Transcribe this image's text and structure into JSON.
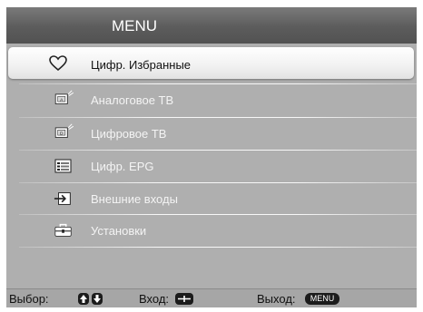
{
  "header": {
    "title": "MENU"
  },
  "menu": {
    "items": [
      {
        "label": "Цифр. Избранные",
        "icon": "heart-icon"
      },
      {
        "label": "Аналоговое ТВ",
        "icon": "analog-tv-icon"
      },
      {
        "label": "Цифровое ТВ",
        "icon": "digital-tv-icon"
      },
      {
        "label": "Цифр. EPG",
        "icon": "epg-guide-icon"
      },
      {
        "label": "Внешние входы",
        "icon": "external-input-icon"
      },
      {
        "label": "Установки",
        "icon": "settings-toolbox-icon"
      }
    ],
    "selected_index": 0
  },
  "status_bar": {
    "select_label": "Выбор:",
    "enter_label": "Вход:",
    "exit_label": "Выход:",
    "exit_key": "MENU"
  }
}
